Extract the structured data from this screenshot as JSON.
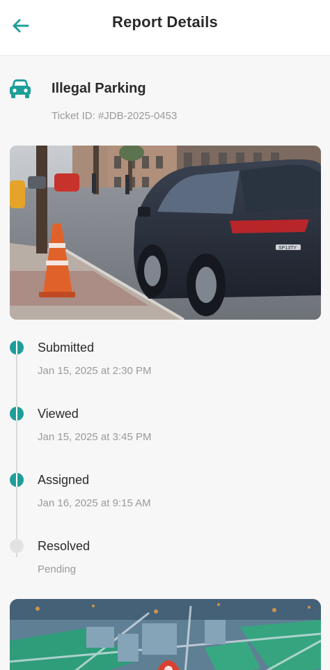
{
  "header": {
    "title": "Report Details",
    "back_icon": "arrow-left-icon"
  },
  "report": {
    "category": "Illegal Parking",
    "category_icon": "car-icon",
    "ticket_id": "Ticket ID: #JDB-2025-0453",
    "photo_plate_text": "SP13TY"
  },
  "timeline": [
    {
      "label": "Submitted",
      "date": "Jan 15, 2025 at 2:30 PM",
      "status": "done"
    },
    {
      "label": "Viewed",
      "date": "Jan 15, 2025 at 3:45 PM",
      "status": "done"
    },
    {
      "label": "Assigned",
      "date": "Jan 16, 2025 at 9:15 AM",
      "status": "done"
    },
    {
      "label": "Resolved",
      "date": "Pending",
      "status": "pending"
    }
  ],
  "colors": {
    "accent": "#1f9e99",
    "pending": "#e2e2e2"
  }
}
